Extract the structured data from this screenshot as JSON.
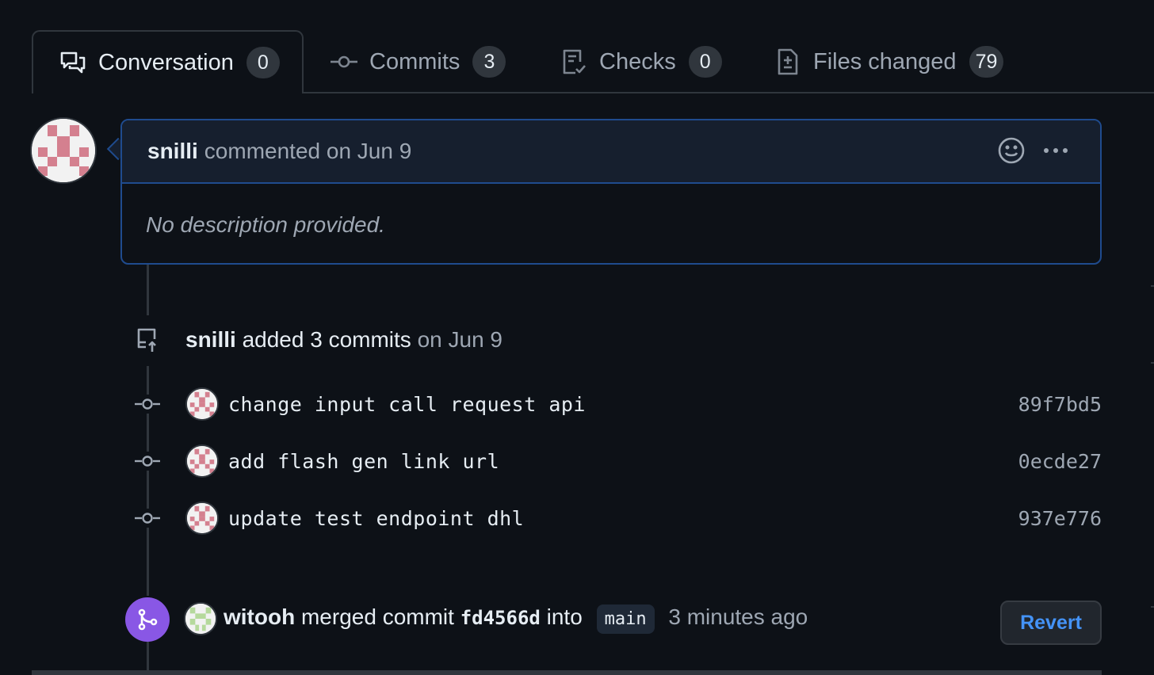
{
  "tabs": [
    {
      "label": "Conversation",
      "count": "0",
      "icon": "comment-discussion-icon",
      "active": true
    },
    {
      "label": "Commits",
      "count": "3",
      "icon": "git-commit-icon",
      "active": false
    },
    {
      "label": "Checks",
      "count": "0",
      "icon": "checklist-icon",
      "active": false
    },
    {
      "label": "Files changed",
      "count": "79",
      "icon": "file-diff-icon",
      "active": false
    }
  ],
  "comment": {
    "author": "snilli",
    "meta": "commented on Jun 9",
    "body": "No description provided."
  },
  "push_event": {
    "author": "snilli",
    "action": "added 3 commits",
    "date": "on Jun 9"
  },
  "commits": [
    {
      "message": "change input call request api",
      "sha": "89f7bd5"
    },
    {
      "message": "add flash gen link url",
      "sha": "0ecde27"
    },
    {
      "message": "update test endpoint dhl",
      "sha": "937e776"
    }
  ],
  "merge": {
    "author": "witooh",
    "action": "merged commit",
    "sha": "fd4566d",
    "into": "into",
    "branch": "main",
    "time": "3 minutes ago",
    "revert_label": "Revert"
  },
  "colors": {
    "background": "#0d1117",
    "comment_border": "#1f4b8e",
    "merged_purple": "#8957e5",
    "link_blue": "#4493f8"
  }
}
